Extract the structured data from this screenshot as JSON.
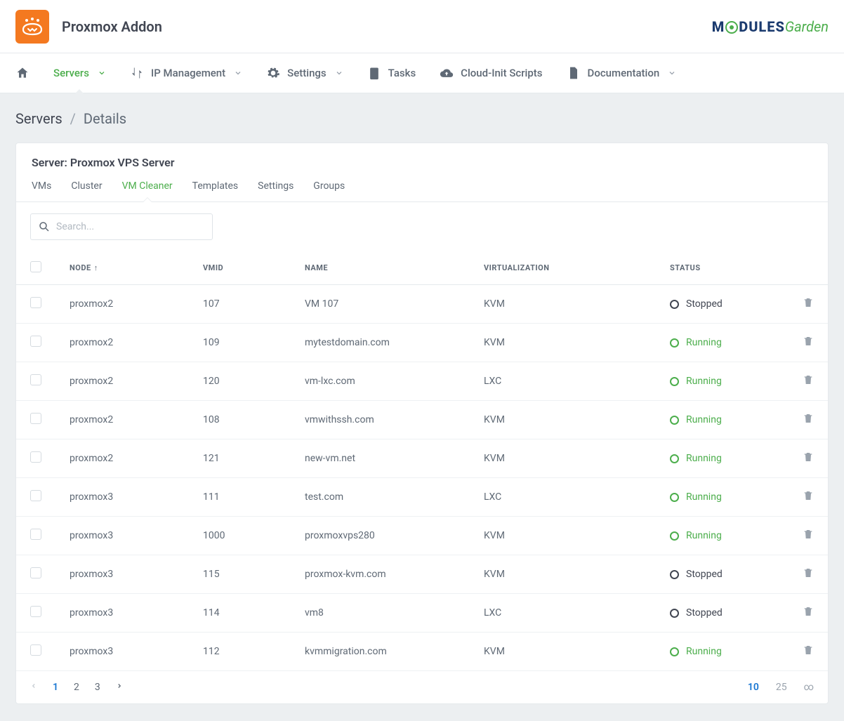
{
  "app_title": "Proxmox Addon",
  "brand": {
    "part1": "M",
    "part2": "DULES",
    "part3": "Garden"
  },
  "nav": [
    {
      "id": "home",
      "label": "",
      "icon": "home",
      "active": false,
      "dropdown": false
    },
    {
      "id": "servers",
      "label": "Servers",
      "icon": "",
      "active": true,
      "dropdown": true
    },
    {
      "id": "ip",
      "label": "IP Management",
      "icon": "swap",
      "active": false,
      "dropdown": true
    },
    {
      "id": "settings",
      "label": "Settings",
      "icon": "gear",
      "active": false,
      "dropdown": true
    },
    {
      "id": "tasks",
      "label": "Tasks",
      "icon": "clipboard",
      "active": false,
      "dropdown": false
    },
    {
      "id": "cloudinit",
      "label": "Cloud-Init Scripts",
      "icon": "cloud",
      "active": false,
      "dropdown": false
    },
    {
      "id": "docs",
      "label": "Documentation",
      "icon": "doc",
      "active": false,
      "dropdown": true
    }
  ],
  "breadcrumb": {
    "root": "Servers",
    "current": "Details"
  },
  "card_title": "Server: Proxmox VPS Server",
  "tabs": [
    "VMs",
    "Cluster",
    "VM Cleaner",
    "Templates",
    "Settings",
    "Groups"
  ],
  "active_tab": "VM Cleaner",
  "search_placeholder": "Search...",
  "columns": {
    "node": "NODE",
    "vmid": "VMID",
    "name": "NAME",
    "virt": "VIRTUALIZATION",
    "status": "STATUS"
  },
  "rows": [
    {
      "node": "proxmox2",
      "vmid": "107",
      "name": "VM 107",
      "virt": "KVM",
      "status": "Stopped"
    },
    {
      "node": "proxmox2",
      "vmid": "109",
      "name": "mytestdomain.com",
      "virt": "KVM",
      "status": "Running"
    },
    {
      "node": "proxmox2",
      "vmid": "120",
      "name": "vm-lxc.com",
      "virt": "LXC",
      "status": "Running"
    },
    {
      "node": "proxmox2",
      "vmid": "108",
      "name": "vmwithssh.com",
      "virt": "KVM",
      "status": "Running"
    },
    {
      "node": "proxmox2",
      "vmid": "121",
      "name": "new-vm.net",
      "virt": "KVM",
      "status": "Running"
    },
    {
      "node": "proxmox3",
      "vmid": "111",
      "name": "test.com",
      "virt": "LXC",
      "status": "Running"
    },
    {
      "node": "proxmox3",
      "vmid": "1000",
      "name": "proxmoxvps280",
      "virt": "KVM",
      "status": "Running"
    },
    {
      "node": "proxmox3",
      "vmid": "115",
      "name": "proxmox-kvm.com",
      "virt": "KVM",
      "status": "Stopped"
    },
    {
      "node": "proxmox3",
      "vmid": "114",
      "name": "vm8",
      "virt": "LXC",
      "status": "Stopped"
    },
    {
      "node": "proxmox3",
      "vmid": "112",
      "name": "kvmmigration.com",
      "virt": "KVM",
      "status": "Running"
    }
  ],
  "pager": {
    "pages": [
      "1",
      "2",
      "3"
    ],
    "active": "1",
    "sizes": [
      "10",
      "25",
      "∞"
    ],
    "active_size": "10"
  }
}
